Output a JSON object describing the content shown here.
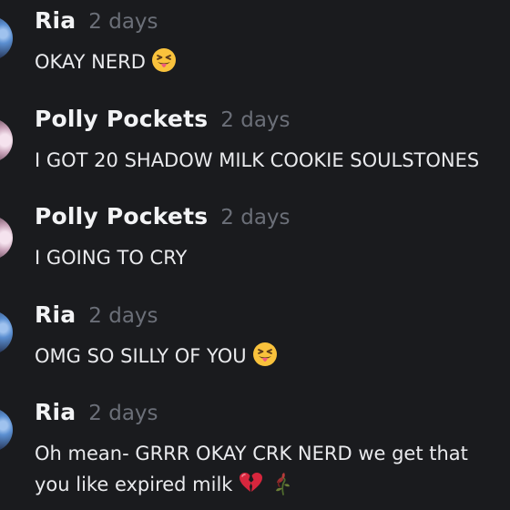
{
  "messages": [
    {
      "author": "Ria",
      "time": "2 days",
      "text": "OKAY NERD",
      "avatar_icon": "user-avatar-ria",
      "emojis": [
        "squinting-face-with-tongue"
      ]
    },
    {
      "author": "Polly Pockets",
      "time": "2 days",
      "text": "I GOT 20 SHADOW MILK COOKIE SOULSTONES",
      "avatar_icon": "user-avatar-polly",
      "emojis": []
    },
    {
      "author": "Polly Pockets",
      "time": "2 days",
      "text": "I GOING TO CRY",
      "avatar_icon": "user-avatar-polly",
      "emojis": []
    },
    {
      "author": "Ria",
      "time": "2 days",
      "text": "OMG SO SILLY OF YOU",
      "avatar_icon": "user-avatar-ria",
      "emojis": [
        "squinting-face-with-tongue"
      ]
    },
    {
      "author": "Ria",
      "time": "2 days",
      "text": "Oh mean- GRRR OKAY CRK NERD we get that you like expired milk",
      "avatar_icon": "user-avatar-ria",
      "emojis": [
        "broken-heart",
        "wilted-flower"
      ]
    }
  ],
  "colors": {
    "background": "#1a1b1e",
    "username": "#f2f3f5",
    "timestamp": "#6b6f78",
    "message_text": "#e9eaed"
  }
}
